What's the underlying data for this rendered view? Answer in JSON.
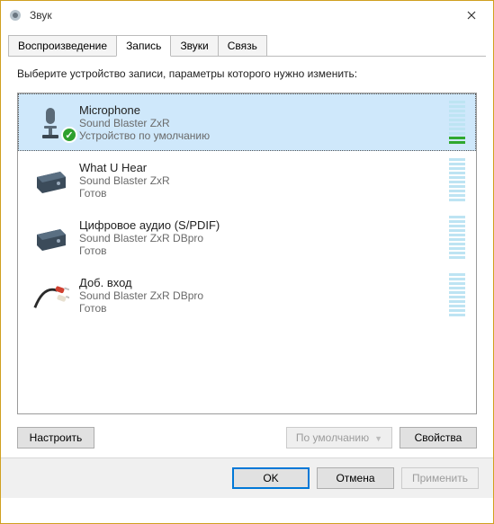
{
  "window": {
    "title": "Звук"
  },
  "tabs": [
    {
      "label": "Воспроизведение",
      "active": false
    },
    {
      "label": "Запись",
      "active": true
    },
    {
      "label": "Звуки",
      "active": false
    },
    {
      "label": "Связь",
      "active": false
    }
  ],
  "instruction": "Выберите устройство записи, параметры которого нужно изменить:",
  "devices": [
    {
      "name": "Microphone",
      "subtitle": "Sound Blaster ZxR",
      "status": "Устройство по умолчанию",
      "selected": true,
      "default": true,
      "icon": "microphone",
      "level": 2
    },
    {
      "name": "What U Hear",
      "subtitle": "Sound Blaster ZxR",
      "status": "Готов",
      "selected": false,
      "default": false,
      "icon": "soundcard",
      "level": 0
    },
    {
      "name": "Цифровое аудио (S/PDIF)",
      "subtitle": "Sound Blaster ZxR DBpro",
      "status": "Готов",
      "selected": false,
      "default": false,
      "icon": "soundcard",
      "level": 0
    },
    {
      "name": "Доб. вход",
      "subtitle": "Sound Blaster ZxR DBpro",
      "status": "Готов",
      "selected": false,
      "default": false,
      "icon": "aux-cable",
      "level": 0
    }
  ],
  "buttons": {
    "configure": "Настроить",
    "set_default": "По умолчанию",
    "properties": "Свойства",
    "ok": "OK",
    "cancel": "Отмена",
    "apply": "Применить"
  }
}
